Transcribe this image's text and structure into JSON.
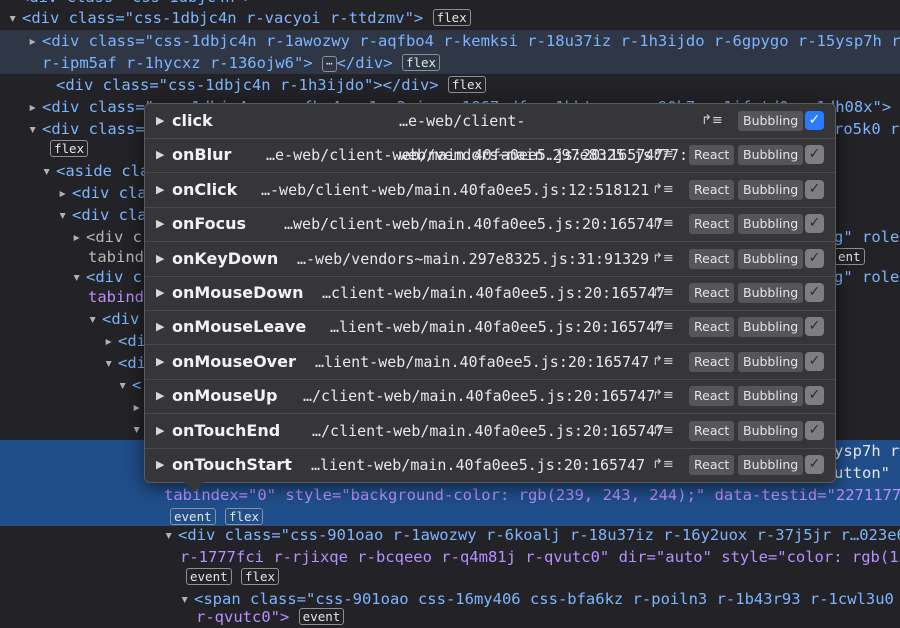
{
  "lines": [
    {
      "text": "<div class=\"css-1dbjc4n r-vacyoi r-ttdzmv\">"
    },
    {
      "text": "<div class=\"css-1dbjc4n r-1awozwy r-aqfbo4 r-kemksi r-18u37iz r-1h3ijdo r-6gpygo r-15ysp7h r-1"
    },
    {
      "text": "r-ipm5af r-1hycxz r-136ojw6\">"
    },
    {
      "text": "<div class=\"css-1dbjc4n r-1h3ijdo\"></div>"
    },
    {
      "text": "<div class=\"css-1dbjc4n r-aqfbo4 r-1ae3gjq r-1867qdf r-1bbtvq r-rs90k7 r-1ifxtd0 r-1dh08x\">"
    },
    {
      "text": "<div class=\"css-1dbjc4n r-1awozwy r-1ro5k0"
    },
    {
      "text": "<aside cla"
    },
    {
      "text": "<div cla"
    },
    {
      "text": "<div cla"
    },
    {
      "text": "<div c"
    },
    {
      "text": "tabind"
    },
    {
      "text": "<div c"
    },
    {
      "text": "tabind"
    },
    {
      "text": "<div"
    },
    {
      "text": "<di"
    },
    {
      "text": "<di"
    },
    {
      "text": "<"
    },
    {
      "text": "ysp7h r-"
    },
    {
      "text": "utton\""
    },
    {
      "text": "tabindex=\"0\" style=\"background-color: rgb(239, 243, 244);\" data-testid=\"22711773"
    },
    {
      "text": "<div class=\"css-901oao r-1awozwy r-6koalj r-18u37iz r-16y2uox r-37j5jr r…023e6"
    },
    {
      "text": "r-1777fci r-rjixqe r-bcqeeo r-q4m81j r-qvutc0\" dir=\"auto\" style=\"color: rgb(15,"
    },
    {
      "text": "<span class=\"css-901oao css-16my406 css-bfa6kz r-poiln3 r-1b43r93 r-1cwl3u0 r-"
    },
    {
      "text": "r-qvutc0\">"
    }
  ],
  "side_fragments": {
    "role1": "g\" role=",
    "event1": "ent",
    "role2": "g\" role=",
    "ro5k0": "ro5k0 r"
  },
  "badges": {
    "flex": "flex",
    "event": "event",
    "ellipsis": "⋯"
  },
  "popup": {
    "react_label": "React",
    "bubbling_label": "Bubbling",
    "jump_icon": "↱≡",
    "rows": [
      {
        "name": "click",
        "source": "…e-web/client-web/vendors~main.297e8325.js:77:25734",
        "react": false,
        "checked": true
      },
      {
        "name": "onBlur",
        "source": "…e-web/client-web/main.40fa0ee5.js:20:165747",
        "react": true,
        "checked": true
      },
      {
        "name": "onClick",
        "source": "…-web/client-web/main.40fa0ee5.js:12:518121",
        "react": true,
        "checked": true
      },
      {
        "name": "onFocus",
        "source": "…web/client-web/main.40fa0ee5.js:20:165747",
        "react": true,
        "checked": true
      },
      {
        "name": "onKeyDown",
        "source": "…-web/vendors~main.297e8325.js:31:91329",
        "react": true,
        "checked": true
      },
      {
        "name": "onMouseDown",
        "source": "…client-web/main.40fa0ee5.js:20:165747",
        "react": true,
        "checked": true
      },
      {
        "name": "onMouseLeave",
        "source": "…lient-web/main.40fa0ee5.js:20:165747",
        "react": true,
        "checked": true
      },
      {
        "name": "onMouseOver",
        "source": "…lient-web/main.40fa0ee5.js:20:165747",
        "react": true,
        "checked": true
      },
      {
        "name": "onMouseUp",
        "source": "…/client-web/main.40fa0ee5.js:20:165747",
        "react": true,
        "checked": true
      },
      {
        "name": "onTouchEnd",
        "source": "…/client-web/main.40fa0ee5.js:20:165747",
        "react": true,
        "checked": true
      },
      {
        "name": "onTouchStart",
        "source": "…lient-web/main.40fa0ee5.js:20:165747",
        "react": true,
        "checked": true
      }
    ]
  },
  "colors": {
    "tag": "#7cb5ff",
    "attribute": "#c792ea",
    "selection": "#204e8a",
    "checkbox_on": "#2b7bff"
  }
}
